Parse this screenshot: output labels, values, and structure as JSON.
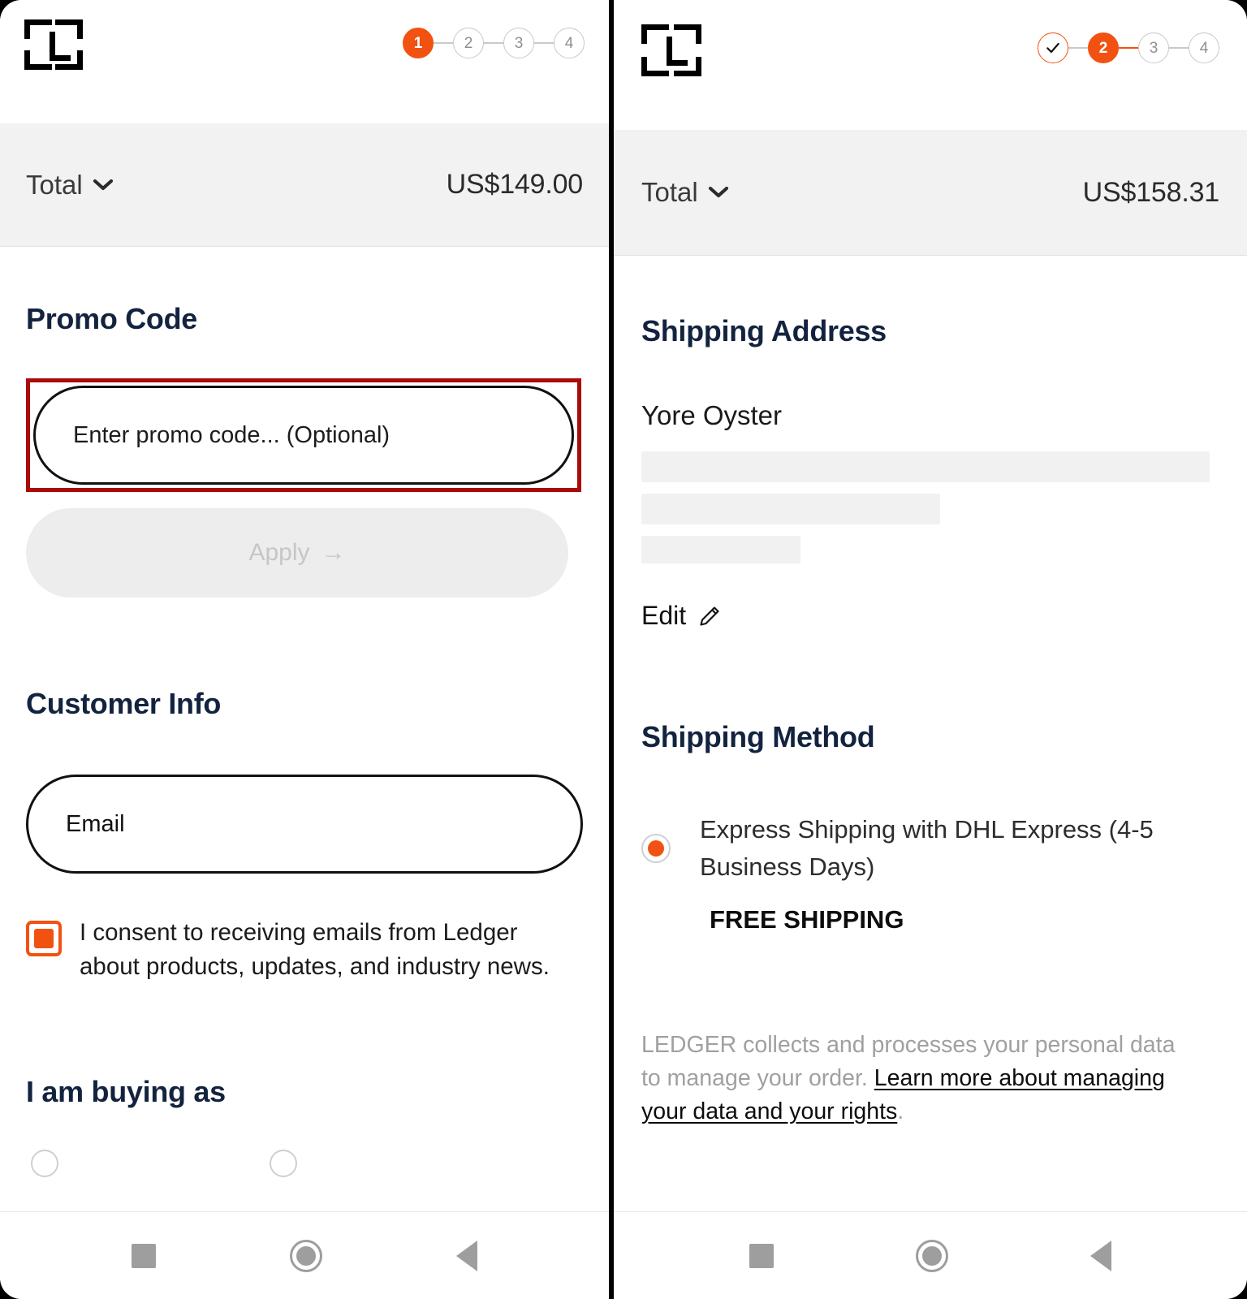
{
  "left_panel": {
    "logo_name": "ledger-logo",
    "stepper": {
      "steps": [
        {
          "label": "1",
          "state": "active"
        },
        {
          "label": "2",
          "state": "inactive"
        },
        {
          "label": "3",
          "state": "inactive"
        },
        {
          "label": "4",
          "state": "inactive"
        }
      ]
    },
    "total": {
      "label": "Total",
      "amount": "US$149.00"
    },
    "promo": {
      "heading": "Promo Code",
      "input_placeholder": "Enter promo code... (Optional)",
      "input_value": "",
      "apply_label": "Apply",
      "apply_arrow": "→"
    },
    "customer": {
      "heading": "Customer Info",
      "email_placeholder": "Email",
      "email_value": "",
      "consent_text": "I consent to receiving emails from Ledger about products, updates, and industry news.",
      "consent_checked": true
    },
    "buying_as": {
      "heading": "I am buying as"
    }
  },
  "right_panel": {
    "logo_name": "ledger-logo",
    "stepper": {
      "steps": [
        {
          "label": "✓",
          "state": "done"
        },
        {
          "label": "2",
          "state": "active"
        },
        {
          "label": "3",
          "state": "inactive"
        },
        {
          "label": "4",
          "state": "inactive"
        }
      ]
    },
    "total": {
      "label": "Total",
      "amount": "US$158.31"
    },
    "shipping_address": {
      "heading": "Shipping Address",
      "recipient": "Yore Oyster",
      "edit_label": "Edit"
    },
    "shipping_method": {
      "heading": "Shipping Method",
      "option_label": "Express Shipping with DHL Express (4-5 Business Days)",
      "option_selected": true,
      "price_label": "FREE SHIPPING"
    },
    "legal": {
      "text_before": "LEDGER collects and processes your personal data to manage your order. ",
      "link_text": "Learn more about managing your data and your rights",
      "text_after": "."
    }
  },
  "android_nav": {
    "recents_label": "recents",
    "home_label": "home",
    "back_label": "back"
  },
  "colors": {
    "accent_orange": "#f25211",
    "annotation_red": "#a90b0b",
    "heading_navy": "#13233f",
    "total_bar_bg": "#f2f2f2",
    "disabled_button_bg": "#ededed",
    "redaction_gray": "#f1f1f1"
  }
}
